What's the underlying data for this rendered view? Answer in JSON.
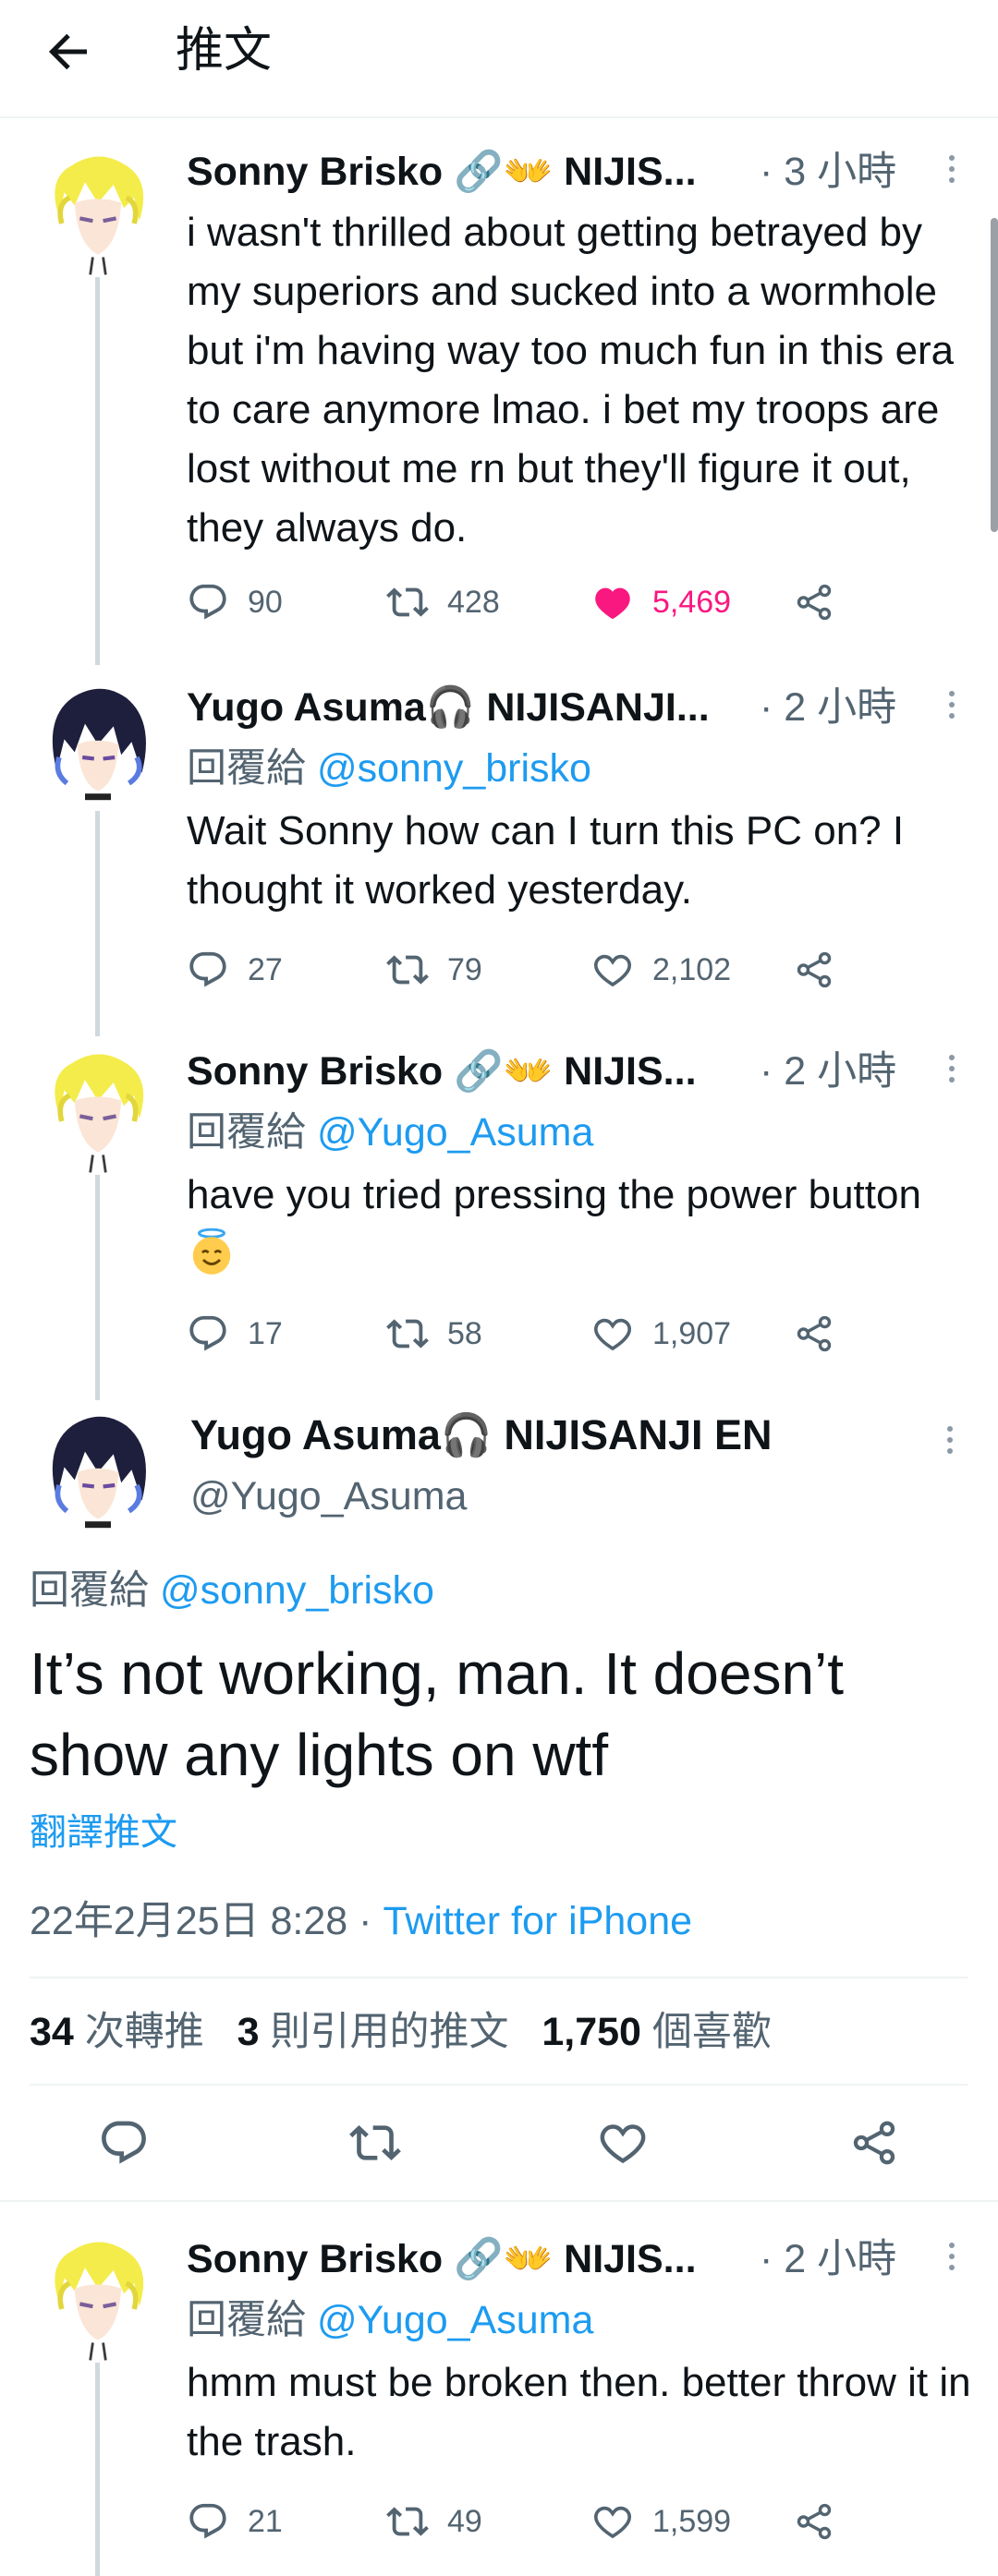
{
  "header": {
    "title": "推文"
  },
  "tweets": [
    {
      "name": "Sonny Brisko 🔗👐 NIJIS...",
      "time": "· 3 小時",
      "text": "i wasn't thrilled about getting betrayed by my superiors and sucked into a wormhole but i'm having way too much fun in this era to care anymore lmao. i bet my troops are lost without me rn but they'll figure it out, they always do.",
      "replies": "90",
      "retweets": "428",
      "likes": "5,469"
    },
    {
      "name": "Yugo Asuma🎧 NIJISANJI...",
      "time": "· 2 小時",
      "reply_prefix": "回覆給",
      "reply_handle": "@sonny_brisko",
      "text": "Wait Sonny how can I turn this PC on? I thought it worked yesterday.",
      "replies": "27",
      "retweets": "79",
      "likes": "2,102"
    },
    {
      "name": "Sonny Brisko 🔗👐 NIJIS...",
      "time": "· 2 小時",
      "reply_prefix": "回覆給",
      "reply_handle": "@Yugo_Asuma",
      "text": "have you tried pressing the power button",
      "replies": "17",
      "retweets": "58",
      "likes": "1,907"
    }
  ],
  "focus": {
    "name": "Yugo Asuma🎧 NIJISANJI EN",
    "handle": "@Yugo_Asuma",
    "reply_prefix": "回覆給",
    "reply_handle": "@sonny_brisko",
    "text": "It’s not working, man. It doesn’t show any lights on wtf",
    "translate": "翻譯推文",
    "date": "22年2月25日 8:28 · ",
    "source": "Twitter for iPhone",
    "retweet_count": "34",
    "retweet_label": "次轉推",
    "quote_count": "3",
    "quote_label": "則引用的推文",
    "like_count": "1,750",
    "like_label": "個喜歡"
  },
  "last_reply": {
    "name": "Sonny Brisko 🔗👐 NIJIS...",
    "time": "· 2 小時",
    "reply_prefix": "回覆給",
    "reply_handle": "@Yugo_Asuma",
    "text": "hmm must be broken then. better throw it in the trash.",
    "replies": "21",
    "retweets": "49",
    "likes": "1,599"
  },
  "colors": {
    "link": "#1d9bf0",
    "like": "#f91880",
    "muted": "#536471",
    "thread": "#cfd9de"
  }
}
